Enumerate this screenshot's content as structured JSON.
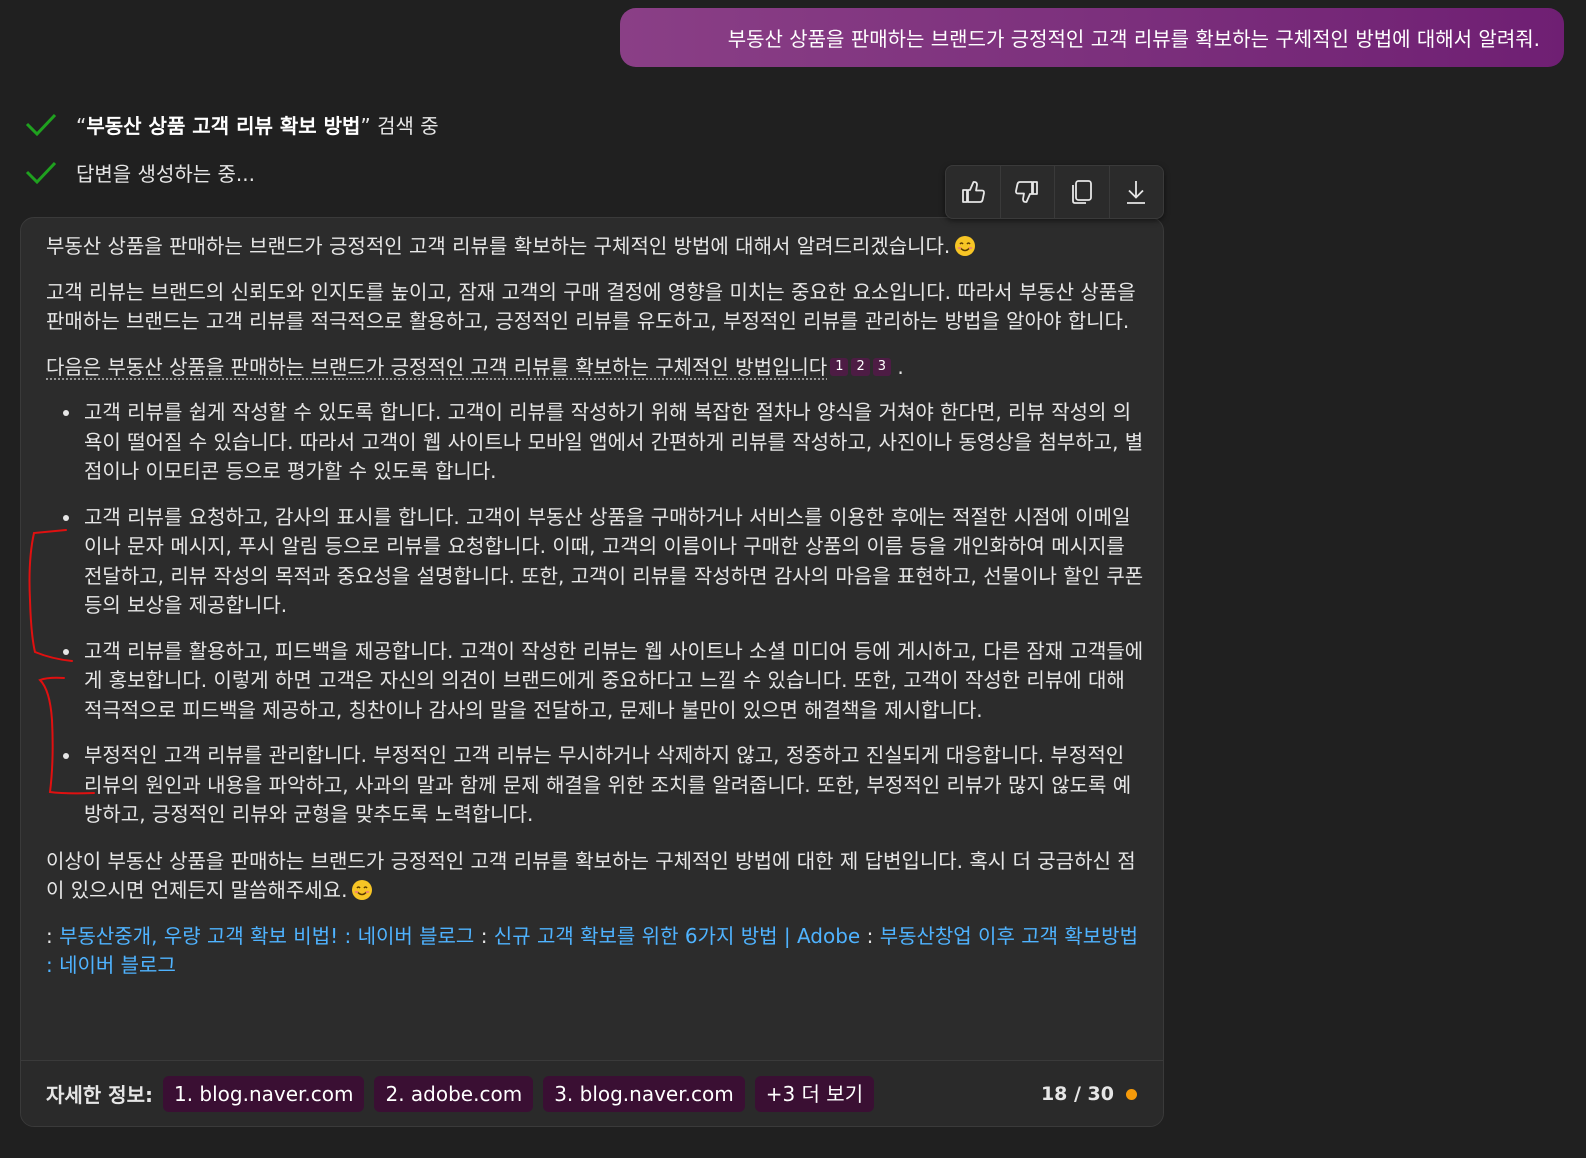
{
  "user_message": "부동산 상품을 판매하는 브랜드가 긍정적인 고객 리뷰를 확보하는 구체적인 방법에 대해서 알려줘.",
  "status": {
    "search_quote_open": "“",
    "search_query": "부동산 상품 고객 리뷰 확보 방법",
    "search_quote_close": "”",
    "search_suffix": " 검색 중",
    "generating": "답변을 생성하는 중..."
  },
  "response": {
    "intro": "부동산 상품을 판매하는 브랜드가 긍정적인 고객 리뷰를 확보하는 구체적인 방법에 대해서 알려드리겠습니다.",
    "para1": "고객 리뷰는 브랜드의 신뢰도와 인지도를 높이고, 잠재 고객의 구매 결정에 영향을 미치는 중요한 요소입니다. 따라서 부동산 상품을 판매하는 브랜드는 고객 리뷰를 적극적으로 활용하고, 긍정적인 리뷰를 유도하고, 부정적인 리뷰를 관리하는 방법을 알아야 합니다.",
    "para2": "다음은 부동산 상품을 판매하는 브랜드가 긍정적인 고객 리뷰를 확보하는 구체적인 방법입니다",
    "citations": [
      "1",
      "2",
      "3"
    ],
    "para2_end": ".",
    "bullets": [
      "고객 리뷰를 쉽게 작성할 수 있도록 합니다. 고객이 리뷰를 작성하기 위해 복잡한 절차나 양식을 거쳐야 한다면, 리뷰 작성의 의욕이 떨어질 수 있습니다. 따라서 고객이 웹 사이트나 모바일 앱에서 간편하게 리뷰를 작성하고, 사진이나 동영상을 첨부하고, 별점이나 이모티콘 등으로 평가할 수 있도록 합니다.",
      "고객 리뷰를 요청하고, 감사의 표시를 합니다. 고객이 부동산 상품을 구매하거나 서비스를 이용한 후에는 적절한 시점에 이메일이나 문자 메시지, 푸시 알림 등으로 리뷰를 요청합니다. 이때, 고객의 이름이나 구매한 상품의 이름 등을 개인화하여 메시지를 전달하고, 리뷰 작성의 목적과 중요성을 설명합니다. 또한, 고객이 리뷰를 작성하면 감사의 마음을 표현하고, 선물이나 할인 쿠폰 등의 보상을 제공합니다.",
      "고객 리뷰를 활용하고, 피드백을 제공합니다. 고객이 작성한 리뷰는 웹 사이트나 소셜 미디어 등에 게시하고, 다른 잠재 고객들에게 홍보합니다. 이렇게 하면 고객은 자신의 의견이 브랜드에게 중요하다고 느낄 수 있습니다. 또한, 고객이 작성한 리뷰에 대해 적극적으로 피드백을 제공하고, 칭찬이나 감사의 말을 전달하고, 문제나 불만이 있으면 해결책을 제시합니다.",
      "부정적인 고객 리뷰를 관리합니다. 부정적인 고객 리뷰는 무시하거나 삭제하지 않고, 정중하고 진실되게 대응합니다. 부정적인 리뷰의 원인과 내용을 파악하고, 사과의 말과 함께 문제 해결을 위한 조치를 알려줍니다. 또한, 부정적인 리뷰가 많지 않도록 예방하고, 긍정적인 리뷰와 균형을 맞추도록 노력합니다."
    ],
    "closing": "이상이 부동산 상품을 판매하는 브랜드가 긍정적인 고객 리뷰를 확보하는 구체적인 방법에 대한 제 답변입니다. 혹시 더 궁금하신 점이 있으시면 언제든지 말씀해주세요.",
    "link_separator": ": ",
    "links": [
      "부동산중개, 우량 고객 확보 비법! : 네이버 블로그",
      "신규 고객 확보를 위한 6가지 방법 | Adobe",
      "부동산창업 이후 고객 확보방법 : 네이버 블로그"
    ]
  },
  "footer": {
    "label": "자세한 정보:",
    "sources": [
      "1. blog.naver.com",
      "2. adobe.com",
      "3. blog.naver.com"
    ],
    "more": "+3 더 보기",
    "counter": "18 / 30"
  },
  "colors": {
    "user_bubble": "#7b2f7c",
    "link": "#4fb3ff",
    "chip_bg": "#3a0f33",
    "status_dot": "#f59a0a",
    "check": "#1fa11f",
    "annotation": "#e01010"
  }
}
